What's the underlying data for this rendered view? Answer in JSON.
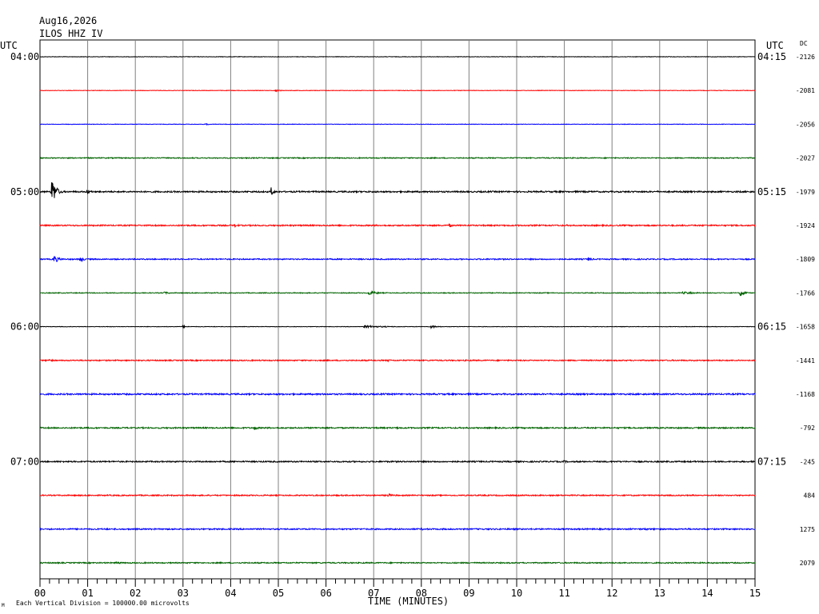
{
  "header": {
    "date": "Aug16,2026",
    "station": "ILOS HHZ IV"
  },
  "left_axis_title": "UTC",
  "right_axis_title": "UTC",
  "dc_label": "DC",
  "x_axis_title": "TIME (MINUTES)",
  "footer_note": "Each Vertical Division = 100000.00 microvolts",
  "footer_mark": "M",
  "colors": {
    "black": "#000000",
    "red": "#ff0000",
    "blue": "#0000ff",
    "green": "#006400",
    "grid": "#808080"
  },
  "chart_data": {
    "type": "line",
    "description_of_axes": "helicorder",
    "x": {
      "min": 0,
      "max": 15,
      "unit": "minutes"
    },
    "x_tick_labels": [
      "00",
      "01",
      "02",
      "03",
      "04",
      "05",
      "06",
      "07",
      "08",
      "09",
      "10",
      "11",
      "12",
      "13",
      "14",
      "15"
    ],
    "left_time_labels": [
      {
        "row": 0,
        "label": "04:00"
      },
      {
        "row": 4,
        "label": "05:00"
      },
      {
        "row": 8,
        "label": "06:00"
      },
      {
        "row": 12,
        "label": "07:00"
      }
    ],
    "right_time_labels": [
      {
        "row": 0,
        "label": "04:15"
      },
      {
        "row": 4,
        "label": "05:15"
      },
      {
        "row": 8,
        "label": "06:15"
      },
      {
        "row": 12,
        "label": "07:15"
      }
    ],
    "dc_offsets": [
      "-2126",
      "-2081",
      "-2056",
      "-2027",
      "-1979",
      "-1924",
      "-1809",
      "-1766",
      "-1658",
      "-1441",
      "-1168",
      "-792",
      "-245",
      "484",
      "1275",
      "2079"
    ],
    "series": [
      {
        "row": 0,
        "color": "black",
        "noise": 0.3,
        "events": []
      },
      {
        "row": 1,
        "color": "red",
        "noise": 0.3,
        "events": [
          {
            "t": 4.95,
            "amp": 1.5,
            "dur": 0.3
          }
        ]
      },
      {
        "row": 2,
        "color": "blue",
        "noise": 0.3,
        "events": [
          {
            "t": 3.5,
            "amp": 1.5,
            "dur": 0.1
          }
        ]
      },
      {
        "row": 3,
        "color": "green",
        "noise": 0.6,
        "events": []
      },
      {
        "row": 4,
        "color": "black",
        "noise": 0.9,
        "events": [
          {
            "t": 0.25,
            "amp": 18,
            "dur": 0.25
          },
          {
            "t": 1.0,
            "amp": 3,
            "dur": 0.3
          },
          {
            "t": 4.85,
            "amp": 6,
            "dur": 0.15
          }
        ]
      },
      {
        "row": 5,
        "color": "red",
        "noise": 0.8,
        "events": [
          {
            "t": 4.1,
            "amp": 2,
            "dur": 0.3
          },
          {
            "t": 8.6,
            "amp": 2,
            "dur": 0.2
          }
        ]
      },
      {
        "row": 6,
        "color": "blue",
        "noise": 0.7,
        "events": [
          {
            "t": 0.3,
            "amp": 5,
            "dur": 0.3
          },
          {
            "t": 0.85,
            "amp": 4,
            "dur": 0.2
          },
          {
            "t": 11.5,
            "amp": 2.5,
            "dur": 0.3
          }
        ]
      },
      {
        "row": 7,
        "color": "green",
        "noise": 0.5,
        "events": [
          {
            "t": 2.6,
            "amp": 1.5,
            "dur": 0.5
          },
          {
            "t": 6.9,
            "amp": 2.5,
            "dur": 0.6
          },
          {
            "t": 14.7,
            "amp": 4,
            "dur": 0.3
          },
          {
            "t": 13.5,
            "amp": 1.5,
            "dur": 1.0
          }
        ]
      },
      {
        "row": 8,
        "color": "black",
        "noise": 0.3,
        "events": [
          {
            "t": 3.0,
            "amp": 1.5,
            "dur": 0.3
          },
          {
            "t": 6.8,
            "amp": 1.5,
            "dur": 1.5
          },
          {
            "t": 8.2,
            "amp": 2,
            "dur": 0.4
          }
        ]
      },
      {
        "row": 9,
        "color": "red",
        "noise": 0.7,
        "events": [
          {
            "t": 0.2,
            "amp": 2,
            "dur": 0.2
          },
          {
            "t": 7.3,
            "amp": 1.5,
            "dur": 0.3
          }
        ]
      },
      {
        "row": 10,
        "color": "blue",
        "noise": 0.9,
        "events": []
      },
      {
        "row": 11,
        "color": "green",
        "noise": 0.8,
        "events": [
          {
            "t": 4.5,
            "amp": 2.5,
            "dur": 0.3
          },
          {
            "t": 7.5,
            "amp": 2,
            "dur": 0.2
          }
        ]
      },
      {
        "row": 12,
        "color": "black",
        "noise": 0.8,
        "events": [
          {
            "t": 11.0,
            "amp": 1.5,
            "dur": 0.3
          }
        ]
      },
      {
        "row": 13,
        "color": "red",
        "noise": 0.7,
        "events": [
          {
            "t": 7.3,
            "amp": 2,
            "dur": 0.4
          }
        ]
      },
      {
        "row": 14,
        "color": "blue",
        "noise": 0.8,
        "events": [
          {
            "t": 8.0,
            "amp": 1.5,
            "dur": 0.4
          },
          {
            "t": 12.7,
            "amp": 1.5,
            "dur": 0.3
          }
        ]
      },
      {
        "row": 15,
        "color": "green",
        "noise": 0.7,
        "events": [
          {
            "t": 1.6,
            "amp": 1.5,
            "dur": 0.5
          }
        ]
      }
    ]
  }
}
